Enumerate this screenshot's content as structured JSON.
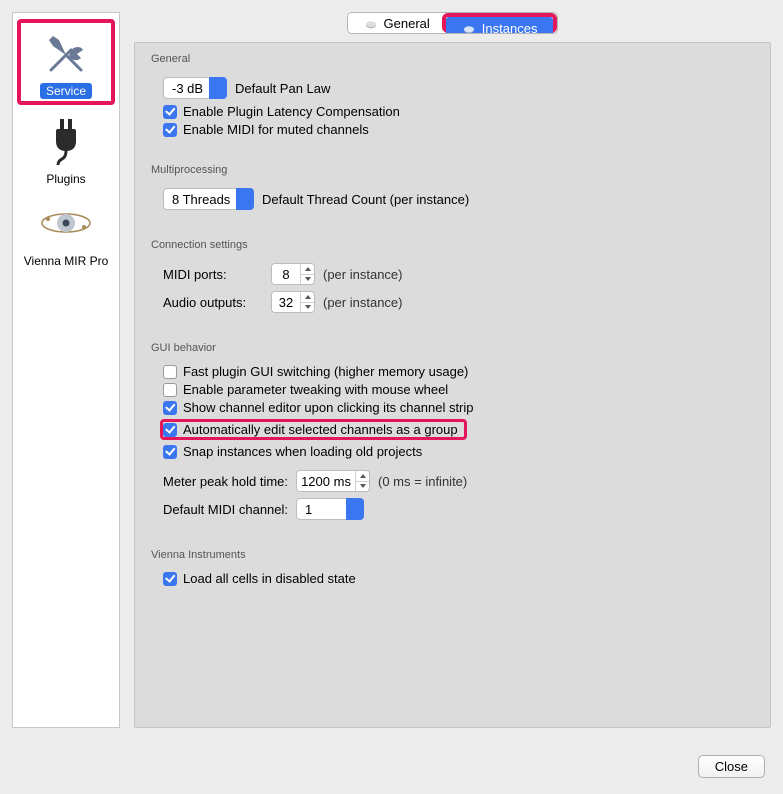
{
  "sidebar": {
    "items": [
      {
        "id": "service",
        "label": "Service",
        "selected": true
      },
      {
        "id": "plugins",
        "label": "Plugins",
        "selected": false
      },
      {
        "id": "vienna-mir-pro",
        "label": "Vienna MIR Pro",
        "selected": false
      }
    ]
  },
  "tabs": {
    "general": "General",
    "instances": "Instances",
    "active": "instances"
  },
  "sections": {
    "general": {
      "header": "General",
      "pan_law": {
        "value": "-3 dB",
        "label": "Default Pan Law"
      },
      "enable_plugin_latency": {
        "checked": true,
        "label": "Enable Plugin Latency Compensation"
      },
      "enable_midi_muted": {
        "checked": true,
        "label": "Enable MIDI for muted channels"
      }
    },
    "multiprocessing": {
      "header": "Multiprocessing",
      "threads": {
        "value": "8 Threads",
        "label": "Default Thread Count (per instance)"
      }
    },
    "connection": {
      "header": "Connection settings",
      "midi_ports": {
        "label": "MIDI ports:",
        "value": "8",
        "suffix": "(per instance)"
      },
      "audio_outputs": {
        "label": "Audio outputs:",
        "value": "32",
        "suffix": "(per instance)"
      }
    },
    "gui": {
      "header": "GUI behavior",
      "fast_switching": {
        "checked": false,
        "label": "Fast plugin GUI switching (higher memory usage)"
      },
      "param_tweaking": {
        "checked": false,
        "label": "Enable parameter tweaking with mouse wheel"
      },
      "show_channel_editor": {
        "checked": true,
        "label": "Show channel editor upon clicking its channel strip"
      },
      "auto_edit_group": {
        "checked": true,
        "label": "Automatically edit selected channels as a group"
      },
      "snap_instances": {
        "checked": true,
        "label": "Snap instances when loading old projects"
      },
      "meter_peak": {
        "label": "Meter peak hold time:",
        "value": "1200 ms",
        "suffix": "(0 ms = infinite)"
      },
      "default_midi_channel": {
        "label": "Default MIDI channel:",
        "value": "1"
      }
    },
    "vienna_instruments": {
      "header": "Vienna Instruments",
      "load_disabled": {
        "checked": true,
        "label": "Load all cells in disabled state"
      }
    }
  },
  "footer": {
    "close": "Close"
  }
}
